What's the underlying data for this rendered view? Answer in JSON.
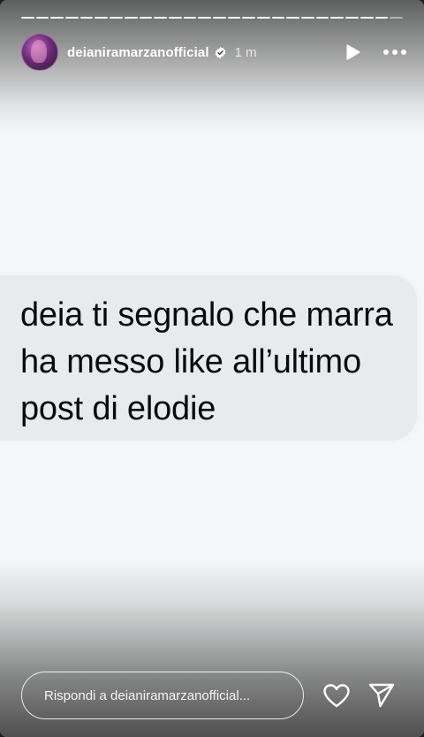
{
  "header": {
    "username": "deianiramarzanofficial",
    "timestamp": "1 m",
    "verified": true,
    "icons": [
      "play-icon",
      "more-options-icon"
    ]
  },
  "progress": {
    "segments_total": 26,
    "current_segment": 26
  },
  "message": {
    "lines": [
      "deia ti segnalo che marra",
      "ha messo like all’ultimo",
      "post di elodie"
    ]
  },
  "footer": {
    "reply_placeholder": "Rispondi a deianiramarzanofficial...",
    "icons": [
      "heart-icon",
      "share-icon"
    ]
  },
  "colors": {
    "story_background": "#f5f6f7",
    "bubble": "#e8eaee",
    "text": "#0a0a0a"
  }
}
